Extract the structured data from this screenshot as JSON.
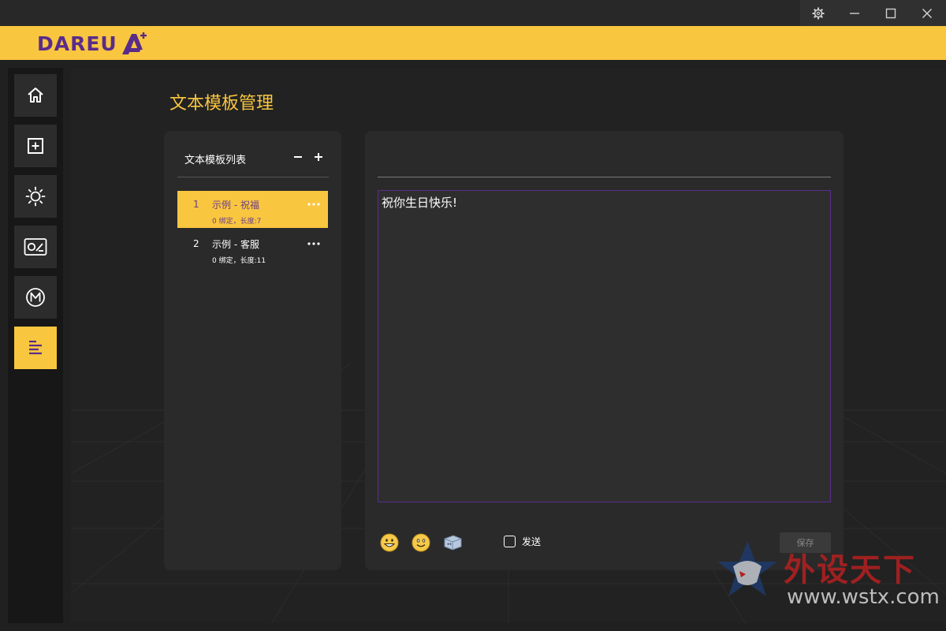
{
  "window": {
    "controls": [
      "settings",
      "minimize",
      "maximize",
      "close"
    ]
  },
  "brand": {
    "logo_text": "DAREU",
    "logo_suffix": "A",
    "colors": {
      "accent": "#f9c63f",
      "brand_purple": "#5a2c8a"
    }
  },
  "sidebar": {
    "items": [
      {
        "icon": "home-icon",
        "active": false
      },
      {
        "icon": "add-box-icon",
        "active": false
      },
      {
        "icon": "brightness-icon",
        "active": false
      },
      {
        "icon": "performance-icon",
        "active": false
      },
      {
        "icon": "macro-icon",
        "active": false
      },
      {
        "icon": "text-template-icon",
        "active": true
      }
    ]
  },
  "page": {
    "title": "文本模板管理"
  },
  "template_list": {
    "title": "文本模板列表",
    "items": [
      {
        "index": "1",
        "name": "示例 - 祝福",
        "meta": "0 绑定，长度:7",
        "selected": true
      },
      {
        "index": "2",
        "name": "示例 - 客服",
        "meta": "0 绑定，长度:11",
        "selected": false
      }
    ]
  },
  "editor": {
    "name_value": "",
    "content": "祝你生日快乐!",
    "send_label": "发送",
    "send_checked": false,
    "save_label": "保存",
    "toolbar_icons": [
      "emoji-grin-icon",
      "emoji-smile-icon",
      "keyboard-key-icon"
    ]
  },
  "watermark": {
    "cn_text": "外设天下",
    "url": "www.wstx.com"
  }
}
